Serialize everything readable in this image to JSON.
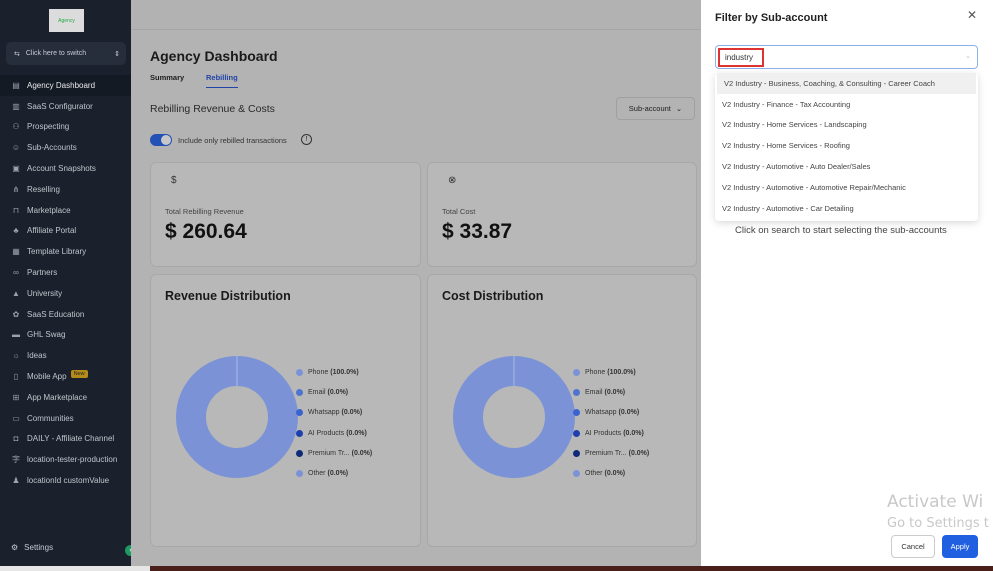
{
  "sidebar": {
    "logo": "Agency",
    "switch_label": "Click here to switch",
    "items": [
      {
        "label": "Agency Dashboard",
        "icon": "dashboard-icon"
      },
      {
        "label": "SaaS Configurator",
        "icon": "chart-icon"
      },
      {
        "label": "Prospecting",
        "icon": "people-icon"
      },
      {
        "label": "Sub-Accounts",
        "icon": "user-icon"
      },
      {
        "label": "Account Snapshots",
        "icon": "snapshot-icon"
      },
      {
        "label": "Reselling",
        "icon": "network-icon"
      },
      {
        "label": "Marketplace",
        "icon": "bag-icon"
      },
      {
        "label": "Affiliate Portal",
        "icon": "group-icon"
      },
      {
        "label": "Template Library",
        "icon": "template-icon"
      },
      {
        "label": "Partners",
        "icon": "handshake-icon"
      },
      {
        "label": "University",
        "icon": "graduation-icon"
      },
      {
        "label": "SaaS Education",
        "icon": "education-icon"
      },
      {
        "label": "GHL Swag",
        "icon": "store-icon"
      },
      {
        "label": "Ideas",
        "icon": "bulb-icon"
      },
      {
        "label": "Mobile App",
        "icon": "mobile-icon",
        "badge": "New"
      },
      {
        "label": "App Marketplace",
        "icon": "apps-icon"
      },
      {
        "label": "Communities",
        "icon": "community-icon"
      },
      {
        "label": "DAILY - Affiliate Channel",
        "icon": "channel-icon"
      },
      {
        "label": "location-tester-production",
        "icon": "text-icon"
      },
      {
        "label": "locationId customValue",
        "icon": "user-add-icon"
      }
    ],
    "settings": "Settings"
  },
  "main": {
    "title": "Agency Dashboard",
    "tabs": [
      "Summary",
      "Rebilling"
    ],
    "section": "Rebilling Revenue & Costs",
    "subaccount_btn": "Sub-account",
    "toggle_label": "Include only rebilled transactions",
    "toggle_on": true,
    "cards": [
      {
        "label": "Total Rebilling Revenue",
        "value": "$ 260.64"
      },
      {
        "label": "Total Cost",
        "value": "$ 33.87"
      }
    ]
  },
  "chart_data": [
    {
      "type": "pie",
      "title": "Revenue Distribution",
      "categories": [
        "Phone",
        "Email",
        "Whatsapp",
        "AI Products",
        "Premium Tr...",
        "Other"
      ],
      "values": [
        100.0,
        0.0,
        0.0,
        0.0,
        0.0,
        0.0
      ],
      "labels": [
        "(100.0%)",
        "(0.0%)",
        "(0.0%)",
        "(0.0%)",
        "(0.0%)",
        "(0.0%)"
      ],
      "colors": [
        "#7b93d6",
        "#4f74cf",
        "#3a63d0",
        "#1e3fae",
        "#0f2a78",
        "#7b93d6"
      ]
    },
    {
      "type": "pie",
      "title": "Cost Distribution",
      "categories": [
        "Phone",
        "Email",
        "Whatsapp",
        "AI Products",
        "Premium Tr...",
        "Other"
      ],
      "values": [
        100.0,
        0.0,
        0.0,
        0.0,
        0.0,
        0.0
      ],
      "labels": [
        "(100.0%)",
        "(0.0%)",
        "(0.0%)",
        "(0.0%)",
        "(0.0%)",
        "(0.0%)"
      ],
      "colors": [
        "#7b93d6",
        "#4f74cf",
        "#3a63d0",
        "#1e3fae",
        "#0f2a78",
        "#7b93d6"
      ]
    }
  ],
  "drawer": {
    "title": "Filter by Sub-account",
    "search_value": "industry",
    "options": [
      "V2 Industry - Business, Coaching, & Consulting - Career Coach",
      "V2 Industry - Finance - Tax Accounting",
      "V2 Industry - Home Services - Landscaping",
      "V2 Industry - Home Services - Roofing",
      "V2 Industry - Automotive - Auto Dealer/Sales",
      "V2 Industry - Automotive - Automotive Repair/Mechanic",
      "V2 Industry - Automotive - Car Detailing"
    ],
    "hint": "Click on search to start selecting the sub-accounts",
    "cancel": "Cancel",
    "apply": "Apply"
  },
  "watermark": {
    "line1": "Activate Wi",
    "line2": "Go to Settings t"
  }
}
